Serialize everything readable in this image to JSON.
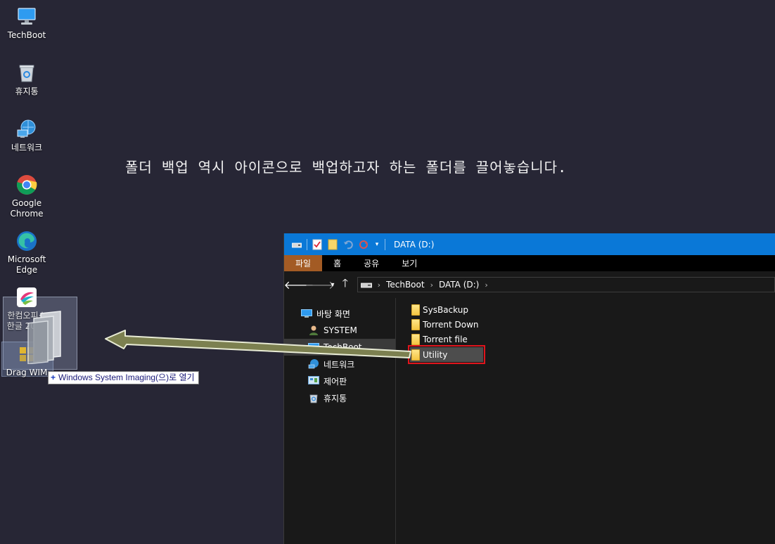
{
  "desktop": {
    "icons": [
      {
        "label": "TechBoot"
      },
      {
        "label": "휴지통"
      },
      {
        "label": "네트워크"
      },
      {
        "label": "Google\nChrome"
      },
      {
        "label": "Microsoft\nEdge"
      },
      {
        "label": "한컴오피스\n한글 2020"
      },
      {
        "label": "Drag WIM"
      }
    ],
    "tooltip": "Windows System Imaging(으)로 열기",
    "caption": "폴더 백업 역시 아이콘으로 백업하고자 하는 폴더를 끌어놓습니다."
  },
  "explorer": {
    "title": "DATA (D:)",
    "ribbon_tabs": [
      "파일",
      "홈",
      "공유",
      "보기"
    ],
    "breadcrumb": [
      "TechBoot",
      "DATA (D:)"
    ],
    "nav_items": [
      "바탕 화면",
      "SYSTEM",
      "TechBoot",
      "네트워크",
      "제어판",
      "휴지통"
    ],
    "selected_nav": "TechBoot",
    "files": [
      "SysBackup",
      "Torrent Down",
      "Torrent file",
      "Utility"
    ],
    "selected_file": "Utility"
  },
  "colors": {
    "desktop_bg": "#272635",
    "titlebar": "#0a78d7",
    "file_tab": "#a35b24",
    "highlight_border": "#e0141c",
    "drag_arrow": "#7c8050"
  }
}
